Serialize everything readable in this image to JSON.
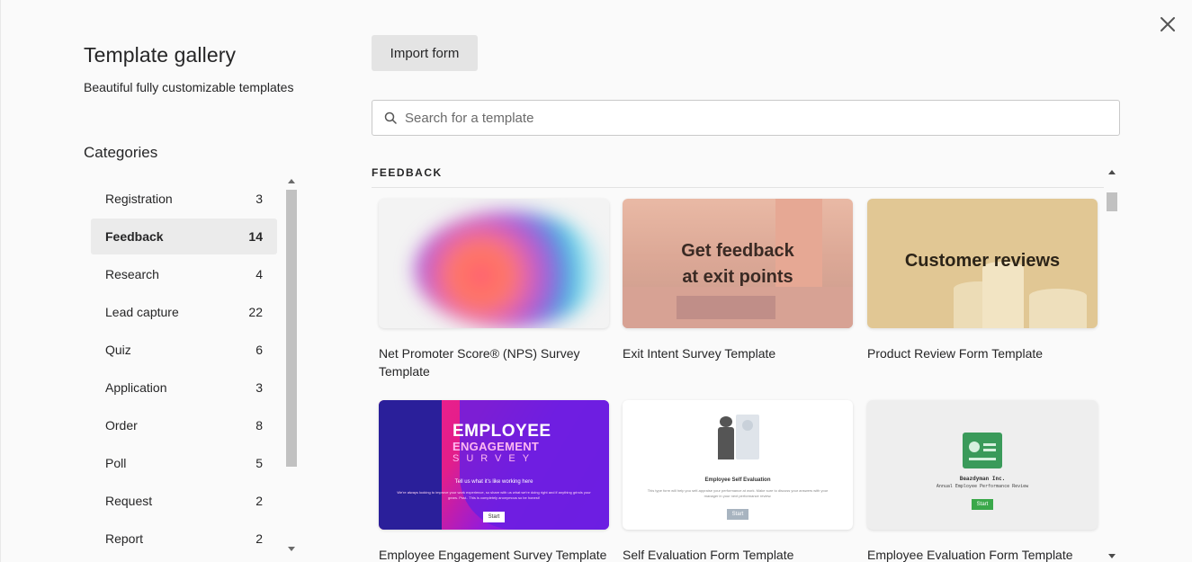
{
  "header": {
    "title": "Template gallery",
    "subtitle": "Beautiful fully customizable templates"
  },
  "categories": {
    "heading": "Categories",
    "items": [
      {
        "label": "Registration",
        "count": "3"
      },
      {
        "label": "Feedback",
        "count": "14",
        "active": true
      },
      {
        "label": "Research",
        "count": "4"
      },
      {
        "label": "Lead capture",
        "count": "22"
      },
      {
        "label": "Quiz",
        "count": "6"
      },
      {
        "label": "Application",
        "count": "3"
      },
      {
        "label": "Order",
        "count": "8"
      },
      {
        "label": "Poll",
        "count": "5"
      },
      {
        "label": "Request",
        "count": "2"
      },
      {
        "label": "Report",
        "count": "2"
      }
    ]
  },
  "toolbar": {
    "import_label": "Import form"
  },
  "search": {
    "placeholder": "Search for a template",
    "value": ""
  },
  "section": {
    "label": "FEEDBACK"
  },
  "templates": [
    {
      "title": "Net Promoter Score® (NPS) Survey Template",
      "thumb_text": ""
    },
    {
      "title": "Exit Intent Survey Template",
      "thumb_text": "Get feedback at exit points"
    },
    {
      "title": "Product Review Form Template",
      "thumb_text": "Customer reviews"
    },
    {
      "title": "Employee Engagement Survey Template",
      "thumb_text": "EMPLOYEE"
    },
    {
      "title": "Self Evaluation Form Template",
      "thumb_text": "Employee Self Evaluation"
    },
    {
      "title": "Employee Evaluation Form Template",
      "thumb_text": "Beazdyman Inc."
    }
  ],
  "thumb_extras": {
    "exit_line1": "Get feedback",
    "exit_line2": "at exit points",
    "emp_line2": "ENGAGEMENT",
    "emp_line3": "SURVEY",
    "emp_tagline": "Tell us what it's like working here",
    "emp_body": "We're always looking to improve your work experience, so share with us what we're doing right and if anything grinds your gears. Psst.. This is completely anonymous so be honest!",
    "start": "Start",
    "self_body": "This type form will help you self-appraise your performance at work. Make sure to discuss your answers with your manager in your next performance review.",
    "eval_subtitle": "Annual Employee Performance Review"
  },
  "colors": {
    "panel_bg": "#fafafa",
    "active_bg": "#ebebeb",
    "button_bg": "#e4e4e4",
    "text": "#262627"
  }
}
